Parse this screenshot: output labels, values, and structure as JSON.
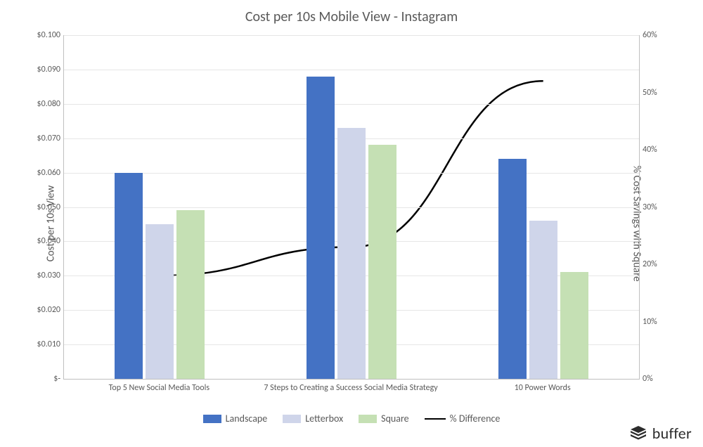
{
  "title": "Cost per 10s Mobile View - Instagram",
  "y1_label": "Cost per 10s View",
  "y2_label": "% Cost Savings with Square",
  "legend": {
    "landscape": "Landscape",
    "letterbox": "Letterbox",
    "square": "Square",
    "pct_diff": "% Difference"
  },
  "brand": "buffer",
  "chart_data": {
    "type": "bar",
    "categories": [
      "Top 5 New Social Media Tools",
      "7 Steps to Creating a Success Social Media Strategy",
      "10 Power Words"
    ],
    "series": [
      {
        "name": "Landscape",
        "values": [
          0.06,
          0.088,
          0.064
        ]
      },
      {
        "name": "Letterbox",
        "values": [
          0.045,
          0.073,
          0.046
        ]
      },
      {
        "name": "Square",
        "values": [
          0.049,
          0.068,
          0.031
        ]
      }
    ],
    "line_series": {
      "name": "% Difference",
      "values": [
        18,
        23,
        52
      ],
      "axis": "y2"
    },
    "y1": {
      "min": 0,
      "max": 0.1,
      "ticks": [
        0,
        0.01,
        0.02,
        0.03,
        0.04,
        0.05,
        0.06,
        0.07,
        0.08,
        0.09,
        0.1
      ],
      "tick_labels": [
        "$-",
        "$0.010",
        "$0.020",
        "$0.030",
        "$0.040",
        "$0.050",
        "$0.060",
        "$0.070",
        "$0.080",
        "$0.090",
        "$0.100"
      ]
    },
    "y2": {
      "min": 0,
      "max": 60,
      "ticks": [
        0,
        10,
        20,
        30,
        40,
        50,
        60
      ],
      "tick_labels": [
        "0%",
        "10%",
        "20%",
        "30%",
        "40%",
        "50%",
        "60%"
      ]
    },
    "colors": {
      "landscape": "#4472c4",
      "letterbox": "#cfd5ea",
      "square": "#c5e0b4",
      "line": "#000000"
    },
    "grid": true,
    "legend_position": "bottom"
  }
}
